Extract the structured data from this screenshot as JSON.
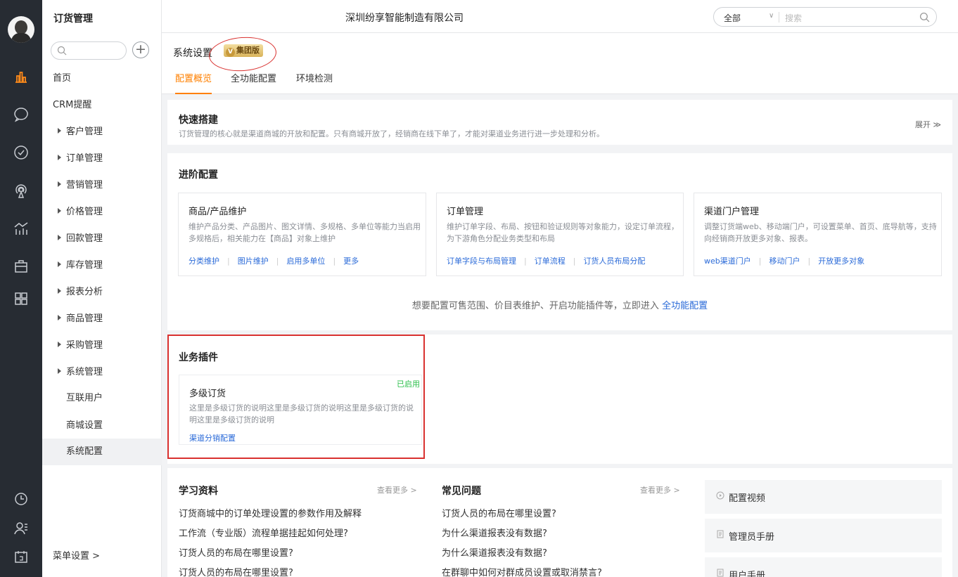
{
  "sidebar": {
    "title": "订货管理",
    "items": [
      {
        "label": "首页",
        "kind": "top"
      },
      {
        "label": "CRM提醒",
        "kind": "top"
      },
      {
        "label": "客户管理",
        "kind": "group"
      },
      {
        "label": "订单管理",
        "kind": "group"
      },
      {
        "label": "营销管理",
        "kind": "group"
      },
      {
        "label": "价格管理",
        "kind": "group"
      },
      {
        "label": "回款管理",
        "kind": "group"
      },
      {
        "label": "库存管理",
        "kind": "group"
      },
      {
        "label": "报表分析",
        "kind": "group"
      },
      {
        "label": "商品管理",
        "kind": "group"
      },
      {
        "label": "采购管理",
        "kind": "group"
      },
      {
        "label": "系统管理",
        "kind": "group"
      },
      {
        "label": "互联用户",
        "kind": "sub"
      },
      {
        "label": "商城设置",
        "kind": "sub"
      },
      {
        "label": "系统配置",
        "kind": "sub",
        "active": true
      }
    ],
    "footer": "菜单设置 >"
  },
  "header": {
    "company": "深圳纷享智能制造有限公司",
    "scope_select": "全部",
    "search_placeholder": "搜索"
  },
  "page": {
    "title": "系统设置",
    "badge": "集团版",
    "tabs": [
      "配置概览",
      "全功能配置",
      "环境检测"
    ]
  },
  "quick": {
    "title": "快速搭建",
    "desc": "订货管理的核心就是渠道商城的开放和配置。只有商城开放了，经销商在线下单了，才能对渠道业务进行进一步处理和分析。",
    "expand": "展开 ≫"
  },
  "advanced": {
    "title": "进阶配置",
    "boxes": [
      {
        "title": "商品/产品维护",
        "desc": "维护产品分类、产品图片、图文详情、多规格、多单位等能力当启用多规格后，相关能力在【商品】对象上维护",
        "links": [
          "分类维护",
          "图片维护",
          "启用多单位",
          "更多"
        ]
      },
      {
        "title": "订单管理",
        "desc": "维护订单字段、布局、按钮和验证规则等对象能力，设定订单流程，为下游角色分配业务类型和布局",
        "links": [
          "订单字段与布局管理",
          "订单流程",
          "订货人员布局分配"
        ]
      },
      {
        "title": "渠道门户管理",
        "desc": "调整订货端web、移动端门户，可设置菜单、首页、底导航等，支持向经销商开放更多对象、报表。",
        "links": [
          "web渠道门户",
          "移动门户",
          "开放更多对象"
        ]
      }
    ],
    "hint_prefix": "想要配置可售范围、价目表维护、开启功能插件等，立即进入 ",
    "hint_link": "全功能配置"
  },
  "plugins": {
    "title": "业务插件",
    "item": {
      "title": "多级订货",
      "status": "已启用",
      "desc": "这里是多级订货的说明这里是多级订货的说明这里是多级订货的说明这里是多级订货的说明",
      "link": "渠道分销配置"
    }
  },
  "learn": {
    "title": "学习资料",
    "more": "查看更多 >",
    "items": [
      "订货商城中的订单处理设置的参数作用及解释",
      "工作流（专业版）流程单据挂起如何处理?",
      "订货人员的布局在哪里设置?",
      "订货人员的布局在哪里设置?"
    ]
  },
  "faq": {
    "title": "常见问题",
    "more": "查看更多 >",
    "items": [
      "订货人员的布局在哪里设置?",
      "为什么渠道报表没有数据?",
      "为什么渠道报表没有数据?",
      "在群聊中如何对群成员设置或取消禁言?"
    ]
  },
  "resources": [
    "配置视频",
    "管理员手册",
    "用户手册"
  ],
  "rail_icons": [
    "dashboard-icon",
    "chat-icon",
    "check-circle-icon",
    "broadcast-icon",
    "chart-icon",
    "briefcase-icon",
    "apps-icon",
    "clock-icon",
    "contacts-icon",
    "calendar-icon"
  ],
  "colors": {
    "accent": "#ff8000",
    "link": "#2a6ad8",
    "rail": "#272c33",
    "enabled": "#2bbf4a",
    "annotation": "#d9312f"
  }
}
